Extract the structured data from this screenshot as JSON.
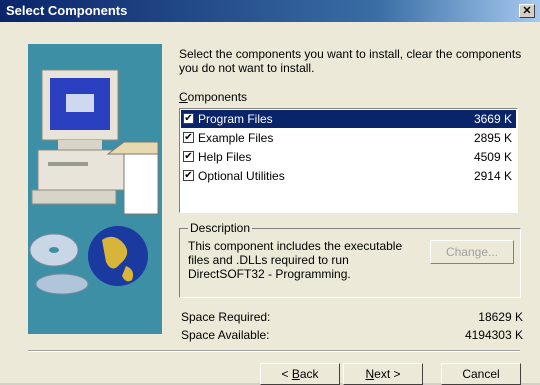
{
  "title": "Select Components",
  "intro": "Select the components you want to install, clear the components you do not want to install.",
  "components_label_prefix": "C",
  "components_label_rest": "omponents",
  "components": [
    {
      "label": "Program Files",
      "size": "3669 K",
      "checked": true,
      "selected": true
    },
    {
      "label": "Example Files",
      "size": "2895 K",
      "checked": true,
      "selected": false
    },
    {
      "label": "Help Files",
      "size": "4509 K",
      "checked": true,
      "selected": false
    },
    {
      "label": "Optional Utilities",
      "size": "2914 K",
      "checked": true,
      "selected": false
    }
  ],
  "description": {
    "legend": "Description",
    "text": "This component includes the executable files and .DLLs required to run DirectSOFT32 - Programming.",
    "change_label": "Change..."
  },
  "space": {
    "required_label": "Space Required:",
    "required_value": "18629 K",
    "available_label": "Space Available:",
    "available_value": "4194303 K"
  },
  "buttons": {
    "back_prefix": "< ",
    "back_key": "B",
    "back_rest": "ack",
    "next_key": "N",
    "next_rest": "ext >",
    "cancel": "Cancel"
  }
}
